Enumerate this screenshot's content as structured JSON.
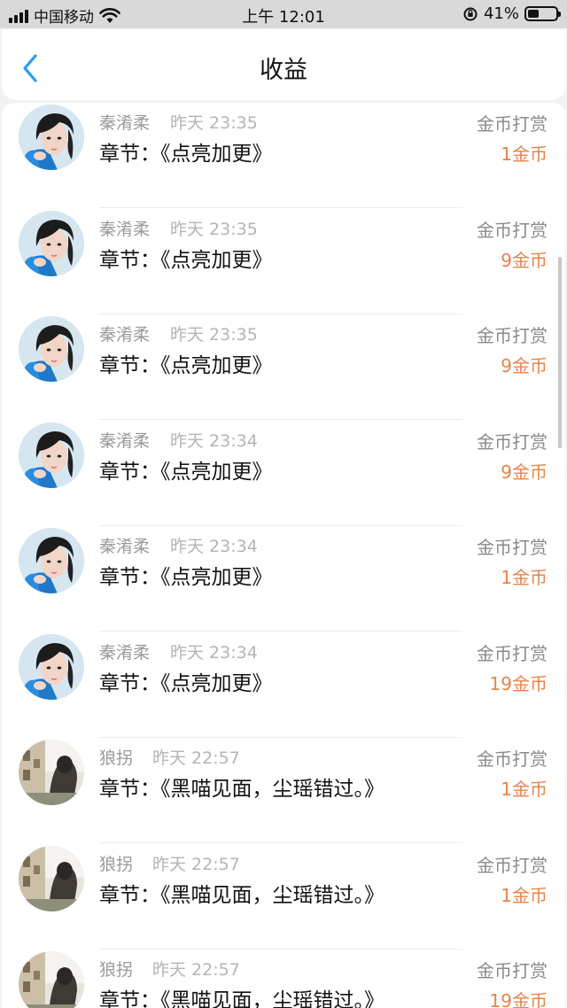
{
  "status_bar": {
    "carrier": "中国移动",
    "time": "上午 12:01",
    "battery_percent": "41%",
    "battery_level": 0.41,
    "icons": [
      "signal-icon",
      "wifi-icon",
      "orientation-lock-icon",
      "battery-icon"
    ]
  },
  "header": {
    "title": "收益",
    "back_icon": "chevron-left-icon",
    "accent_color": "#2b9af3"
  },
  "colors": {
    "amount": "#e8834a",
    "meta": "#9a9a9a"
  },
  "records": [
    {
      "name": "秦淆柔",
      "time": "昨天 23:35",
      "chapter": "章节：《点亮加更》",
      "type": "金币打赏",
      "amount": "1金币",
      "avatar": "avatar-a"
    },
    {
      "name": "秦淆柔",
      "time": "昨天 23:35",
      "chapter": "章节：《点亮加更》",
      "type": "金币打赏",
      "amount": "9金币",
      "avatar": "avatar-a"
    },
    {
      "name": "秦淆柔",
      "time": "昨天 23:35",
      "chapter": "章节：《点亮加更》",
      "type": "金币打赏",
      "amount": "9金币",
      "avatar": "avatar-a"
    },
    {
      "name": "秦淆柔",
      "time": "昨天 23:34",
      "chapter": "章节：《点亮加更》",
      "type": "金币打赏",
      "amount": "9金币",
      "avatar": "avatar-a"
    },
    {
      "name": "秦淆柔",
      "time": "昨天 23:34",
      "chapter": "章节：《点亮加更》",
      "type": "金币打赏",
      "amount": "1金币",
      "avatar": "avatar-a"
    },
    {
      "name": "秦淆柔",
      "time": "昨天 23:34",
      "chapter": "章节：《点亮加更》",
      "type": "金币打赏",
      "amount": "19金币",
      "avatar": "avatar-a"
    },
    {
      "name": "狼拐",
      "time": "昨天 22:57",
      "chapter": "章节：《黑喵见面，尘瑶错过。》",
      "type": "金币打赏",
      "amount": "1金币",
      "avatar": "avatar-b"
    },
    {
      "name": "狼拐",
      "time": "昨天 22:57",
      "chapter": "章节：《黑喵见面，尘瑶错过。》",
      "type": "金币打赏",
      "amount": "1金币",
      "avatar": "avatar-b"
    },
    {
      "name": "狼拐",
      "time": "昨天 22:57",
      "chapter": "章节：《黑喵见面，尘瑶错过。》",
      "type": "金币打赏",
      "amount": "19金币",
      "avatar": "avatar-b"
    }
  ]
}
